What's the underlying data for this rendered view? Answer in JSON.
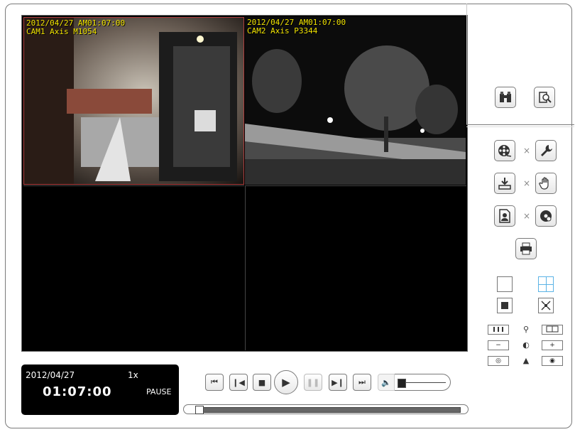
{
  "cameras": [
    {
      "timestamp": "2012/04/27 AM01:07:00",
      "name": "CAM1 Axis M1054",
      "selected": true
    },
    {
      "timestamp": "2012/04/27 AM01:07:00",
      "name": "CAM2 Axis P3344",
      "selected": false
    }
  ],
  "playback_status": {
    "date": "2012/04/27",
    "speed": "1x",
    "time": "01:07:00",
    "state": "PAUSE"
  },
  "toolbar": {
    "x_separator": "×",
    "zoom_minus": "−",
    "zoom_plus": "+"
  },
  "seek_position": 0.0,
  "volume_level": 0.05,
  "colors": {
    "osd_text": "#f2e400",
    "selected_border": "#b04040",
    "layout_active": "#5bb3e6"
  }
}
